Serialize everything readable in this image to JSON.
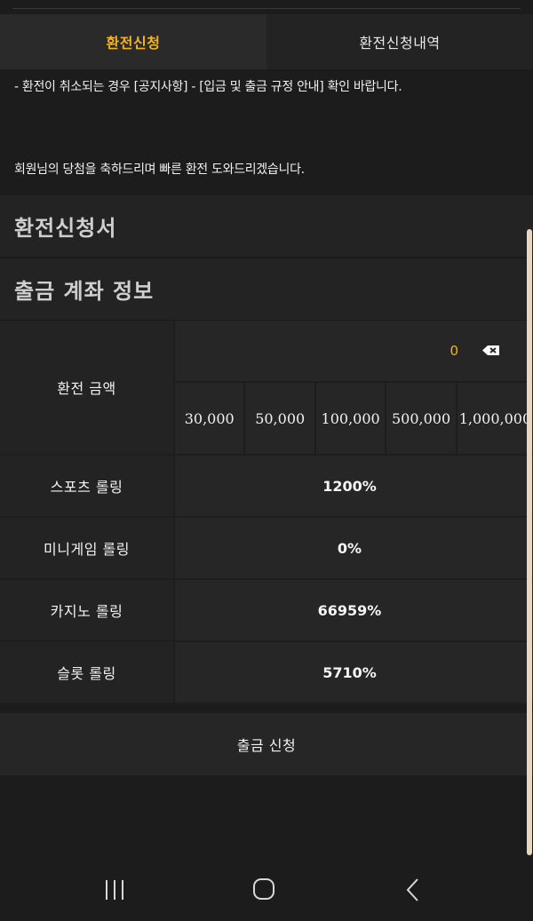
{
  "tabs": [
    {
      "label": "환전신청",
      "active": true
    },
    {
      "label": "환전신청내역",
      "active": false
    }
  ],
  "notice": {
    "line1": "- 환전이 취소되는 경우 [공지사항] - [입금 및 출금 규정 안내] 확인 바랍니다.",
    "line2": "회원님의 당첨을 축하드리며 빠른 환전 도와드리겠습니다."
  },
  "sections": {
    "form_title": "환전신청서",
    "account_title": "출금 계좌 정보"
  },
  "form": {
    "amount_label": "환전 금액",
    "amount_value": "0",
    "amount_buttons": [
      "30,000",
      "50,000",
      "100,000",
      "500,000",
      "1,000,000"
    ],
    "rolling": [
      {
        "label": "스포츠 롤링",
        "value": "1200%"
      },
      {
        "label": "미니게임 롤링",
        "value": "0%"
      },
      {
        "label": "카지노 롤링",
        "value": "66959%"
      },
      {
        "label": "슬롯 롤링",
        "value": "5710%"
      }
    ]
  },
  "submit_label": "출금 신청",
  "colors": {
    "accent": "#f3b321",
    "background": "#1c1c1c",
    "scrollbar": "#e9d6bd"
  },
  "icons": {
    "eraser": "eraser-icon",
    "nav_recent": "recent-apps-icon",
    "nav_home": "home-icon",
    "nav_back": "back-icon"
  }
}
